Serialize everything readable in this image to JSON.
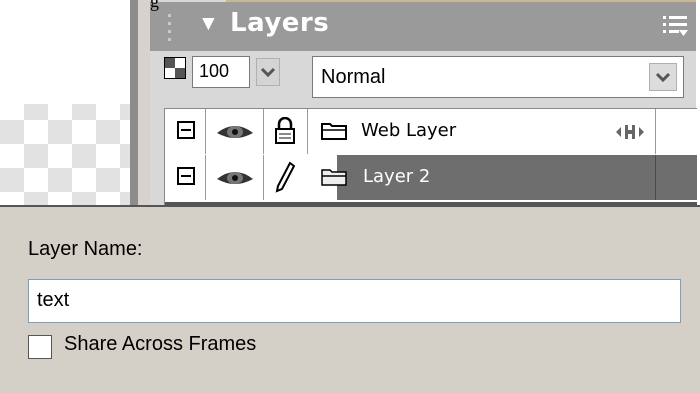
{
  "window": {
    "overlap_fragment": "g"
  },
  "layers_panel": {
    "title": "Layers",
    "opacity_value": "100",
    "blend_mode": "Normal",
    "layers": [
      {
        "name": "Web Layer",
        "selected": false,
        "edit_icon": "lock-icon",
        "extra_icon": "move-handle-icon"
      },
      {
        "name": "Layer 2",
        "selected": true,
        "edit_icon": "pencil-icon"
      }
    ],
    "colors": {
      "header_bg": "#9a9a9a",
      "selected_row_bg": "#6e6e6e",
      "title_text": "#ffffff"
    }
  },
  "dialog": {
    "layer_name_label": "Layer Name:",
    "layer_name_value": "text",
    "share_checkbox_label": "Share Across Frames",
    "share_checked": false
  }
}
